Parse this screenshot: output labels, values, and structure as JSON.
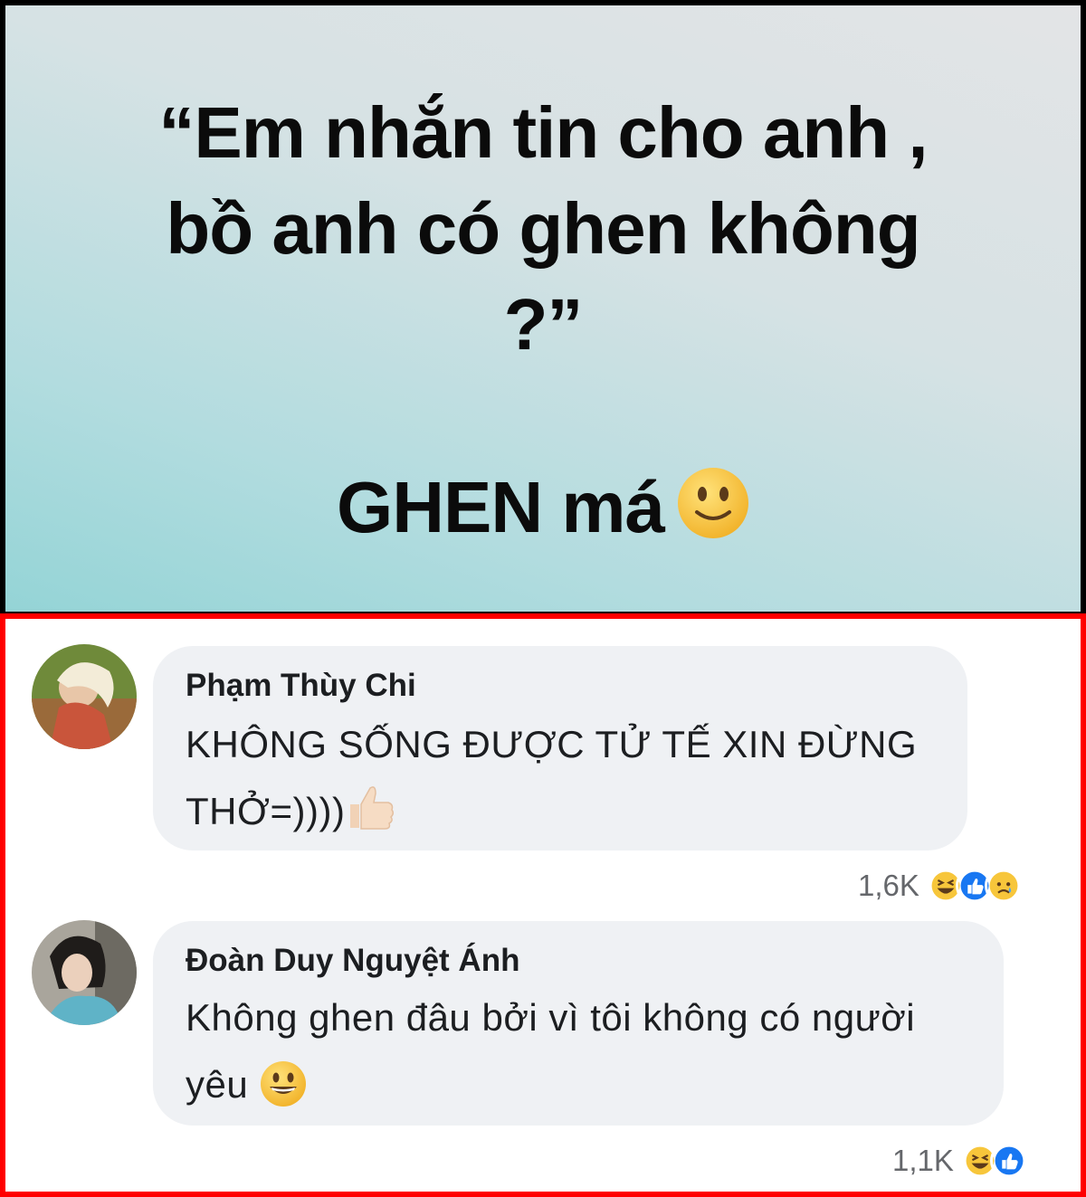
{
  "post": {
    "quote_line1": "“Em nhắn tin cho anh ,",
    "quote_line2": "bồ anh có ghen không",
    "quote_line3": "?”",
    "answer": "GHEN má",
    "answer_emoji": "slightly-smiling-face"
  },
  "comments": [
    {
      "author": "Phạm Thùy Chi",
      "text_line1": "KHÔNG SỐNG ĐƯỢC TỬ TẾ XIN ĐỪNG",
      "text_line2": "THỞ=))))",
      "trailing_emoji": "thumbs-up",
      "reaction_count": "1,6K",
      "reactions": [
        "haha",
        "like",
        "sad"
      ]
    },
    {
      "author": "Đoàn Duy Nguyệt Ánh",
      "text_line1": "Không ghen đâu bởi vì tôi không có người",
      "text_line2": "yêu",
      "trailing_emoji": "grinning-face",
      "reaction_count": "1,1K",
      "reactions": [
        "haha",
        "like"
      ]
    }
  ],
  "colors": {
    "frame_border": "#ff0000",
    "bubble": "#eff1f4",
    "like_blue": "#1877f2",
    "emoji_yellow": "#f7c63b"
  }
}
